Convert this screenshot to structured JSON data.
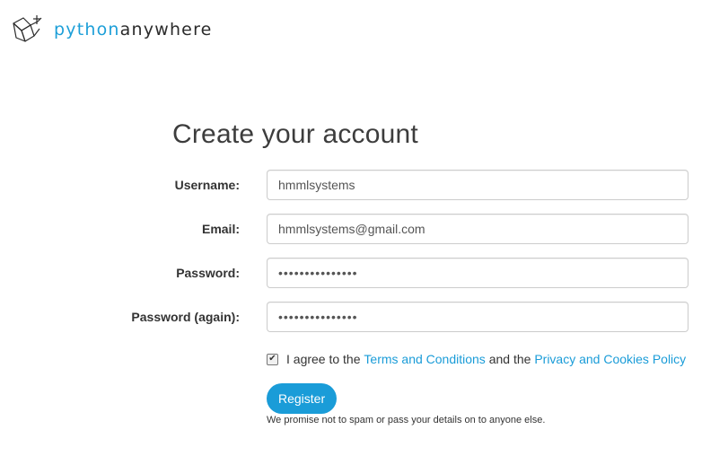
{
  "brand": {
    "name_part1": "python",
    "name_part2": "anywhere",
    "icon": "pythonanywhere-logo-icon",
    "colors": {
      "accent": "#1a9cd8",
      "dark": "#2b2b2b"
    }
  },
  "form": {
    "title": "Create your account",
    "fields": {
      "username": {
        "label": "Username:",
        "value": "hmmlsystems"
      },
      "email": {
        "label": "Email:",
        "value": "hmmlsystems@gmail.com"
      },
      "password": {
        "label": "Password:",
        "value": "•••••••••••••••"
      },
      "password_again": {
        "label": "Password (again):",
        "value": "•••••••••••••••"
      }
    },
    "agreement": {
      "checked": true,
      "text_before": "I agree to the",
      "terms_link": "Terms and Conditions",
      "text_middle": "and the",
      "privacy_link": "Privacy and Cookies Policy"
    },
    "register_label": "Register",
    "promise": "We promise not to spam or pass your details on to anyone else."
  }
}
